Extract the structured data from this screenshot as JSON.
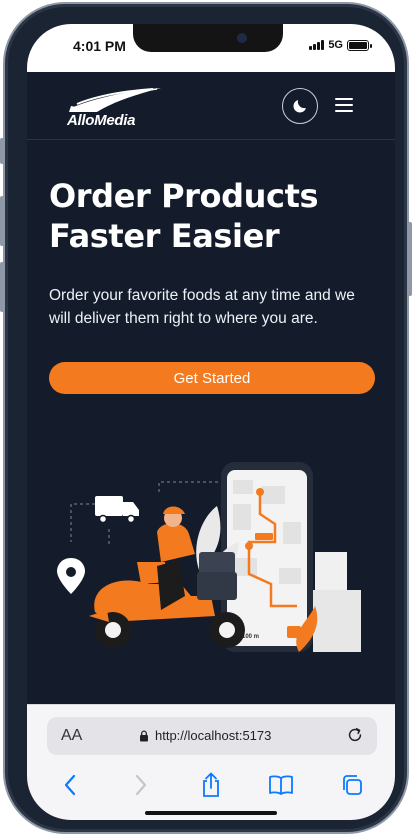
{
  "status_bar": {
    "time": "4:01 PM",
    "network": "5G"
  },
  "navbar": {
    "logo_text": "AlloMedia",
    "theme_toggle_icon": "moon-icon",
    "menu_icon": "hamburger-icon"
  },
  "hero": {
    "title_line1": "Order Products",
    "title_line2": "Faster Easier",
    "subtitle": "Order your favorite foods at any time and we will deliver them right to where you are.",
    "cta_label": "Get Started"
  },
  "illustration": {
    "map_marker_label": "1,100 m",
    "icons": [
      "delivery-truck-icon",
      "location-pin-icon",
      "scooter-rider",
      "smartphone-map",
      "delivery-boxes",
      "leaf-decoration"
    ]
  },
  "browser": {
    "text_size_label": "AA",
    "url": "http://localhost:5173",
    "toolbar_icons": [
      "back-icon",
      "forward-icon",
      "share-icon",
      "bookmarks-icon",
      "tabs-icon"
    ]
  },
  "colors": {
    "background": "#141c2b",
    "accent": "#f47a1f",
    "text": "#ffffff",
    "browser_ui": "#f5f5f7",
    "ios_blue": "#0a7aff"
  }
}
